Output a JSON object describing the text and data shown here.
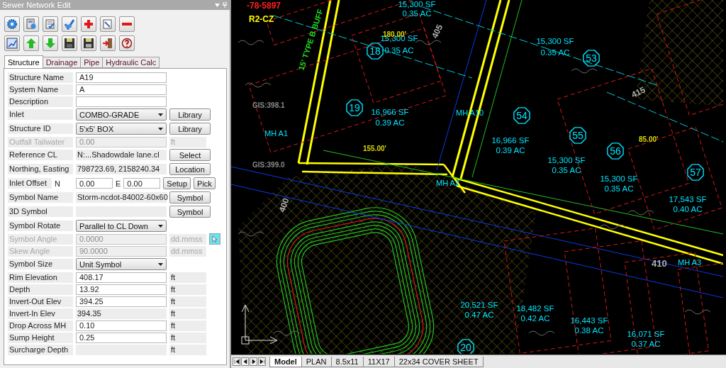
{
  "panel": {
    "title": "Sewer Network Edit"
  },
  "tabs": [
    {
      "label": "Structure",
      "selected": true
    },
    {
      "label": "Drainage",
      "selected": false
    },
    {
      "label": "Pipe",
      "selected": false
    },
    {
      "label": "Hydraulic Calc",
      "selected": false
    }
  ],
  "fields": [
    {
      "label": "Structure Name",
      "kind": "input",
      "value": "A19"
    },
    {
      "label": "System Name",
      "kind": "input",
      "value": "A"
    },
    {
      "label": "Description",
      "kind": "input"
    },
    {
      "label": "Inlet",
      "kind": "select",
      "value": "COMBO-GRADE",
      "button": "Library"
    },
    {
      "label": "Structure ID",
      "kind": "select",
      "value": "5'x5' BOX",
      "button": "Library"
    },
    {
      "label": "Outfall Tailwater",
      "kind": "input",
      "value": "0.00",
      "unit": "ft",
      "disabled": true
    },
    {
      "label": "Reference CL",
      "kind": "text",
      "value": "N:...Shadowdale lane.cl",
      "button": "Select"
    },
    {
      "label": "Northing, Easting",
      "kind": "text",
      "value": "798723.69, 2158240.34",
      "button": "Location"
    },
    {
      "label": "Inlet Offset",
      "kind": "offset",
      "n_label": "N",
      "n_value": "0.00",
      "e_label": "E",
      "e_value": "0.00",
      "buttons": [
        "Setup",
        "Pick"
      ]
    },
    {
      "label": "Symbol Name",
      "kind": "text",
      "value": "Storm-ncdot-84002-60x60",
      "button": "Symbol"
    },
    {
      "label": "3D Symbol",
      "kind": "text",
      "button": "Symbol"
    },
    {
      "label": "Symbol Rotate",
      "kind": "select",
      "value": "Parallel to CL Down"
    },
    {
      "label": "Symbol Angle",
      "kind": "input",
      "value": "0.0000",
      "unit": "dd.mmss",
      "disabled": true,
      "pick": true
    },
    {
      "label": "Skew Angle",
      "kind": "input",
      "value": "90.0000",
      "unit": "dd.mmss",
      "disabled": true
    },
    {
      "label": "Symbol Size",
      "kind": "select",
      "value": "Unit Symbol"
    },
    {
      "label": "Rim Elevation",
      "kind": "input",
      "value": "408.17",
      "unit": "ft"
    },
    {
      "label": "Depth",
      "kind": "input",
      "value": "13.92",
      "unit": "ft"
    },
    {
      "label": "Invert-Out Elev",
      "kind": "input",
      "value": "394.25",
      "unit": "ft"
    },
    {
      "label": "Invert-In Elev",
      "kind": "text",
      "value": "394.35",
      "unit": "ft"
    },
    {
      "label": "Drop Across MH",
      "kind": "input",
      "value": "0.10",
      "unit": "ft"
    },
    {
      "label": "Sump Height",
      "kind": "input",
      "value": "0.25",
      "unit": "ft"
    },
    {
      "label": "Surcharge Depth",
      "kind": "text",
      "unit": "ft"
    }
  ],
  "drawing": {
    "lots": [
      {
        "area": "15,300 SF",
        "acres": "0.35 AC"
      },
      {
        "number": "18",
        "area": "15,300 SF",
        "acres": "0.35 AC"
      },
      {
        "number": "53",
        "area": "15,300 SF",
        "acres": "0.35 AC"
      },
      {
        "number": "19",
        "area": "16,966 SF",
        "acres": "0.39 AC"
      },
      {
        "number": "54",
        "area": "16,966 SF",
        "acres": "0.39 AC"
      },
      {
        "number": "55",
        "area": "15,300 SF",
        "acres": "0.35 AC"
      },
      {
        "number": "56",
        "area": "15,300 SF",
        "acres": "0.35 AC"
      },
      {
        "number": "57",
        "area": "17,543 SF",
        "acres": "0.40 AC"
      },
      {
        "number": "20",
        "area": "20,521 SF",
        "acres": "0.47 AC"
      },
      {
        "area": "18,482 SF",
        "acres": "0.42 AC"
      },
      {
        "area": "16,443 SF",
        "acres": "0.38 AC"
      },
      {
        "area": "16,071 SF",
        "acres": "0.37 AC"
      }
    ],
    "manholes": [
      "MH A1",
      "MH A10",
      "MH A2",
      "MH A3"
    ],
    "annotations": [
      {
        "text": "-78-5897",
        "color": "#ff2020"
      },
      {
        "text": "R2-CZ",
        "color": "#ffff00"
      },
      {
        "text": "15' TYPE B BUFF",
        "color": "#22dd22"
      },
      {
        "text": "180.00'",
        "color": "#d8d800"
      },
      {
        "text": "155.00'",
        "color": "#d8d800"
      },
      {
        "text": "85.00'",
        "color": "#d8d800"
      },
      {
        "text": "405",
        "color": "#b0b0b0"
      },
      {
        "text": "410",
        "color": "#b0b0b0"
      },
      {
        "text": "415",
        "color": "#b0b0b0"
      },
      {
        "text": "400",
        "color": "#b0b0b0"
      },
      {
        "text": "GIS:398.1",
        "color": "#8a8a8a"
      },
      {
        "text": "GIS:399.0",
        "color": "#8a8a8a"
      }
    ]
  },
  "layout_tabs": [
    {
      "label": "Model",
      "selected": true
    },
    {
      "label": "PLAN",
      "selected": false
    },
    {
      "label": "8.5x11",
      "selected": false
    },
    {
      "label": "11X17",
      "selected": false
    },
    {
      "label": "22x34 COVER SHEET",
      "selected": false
    }
  ]
}
